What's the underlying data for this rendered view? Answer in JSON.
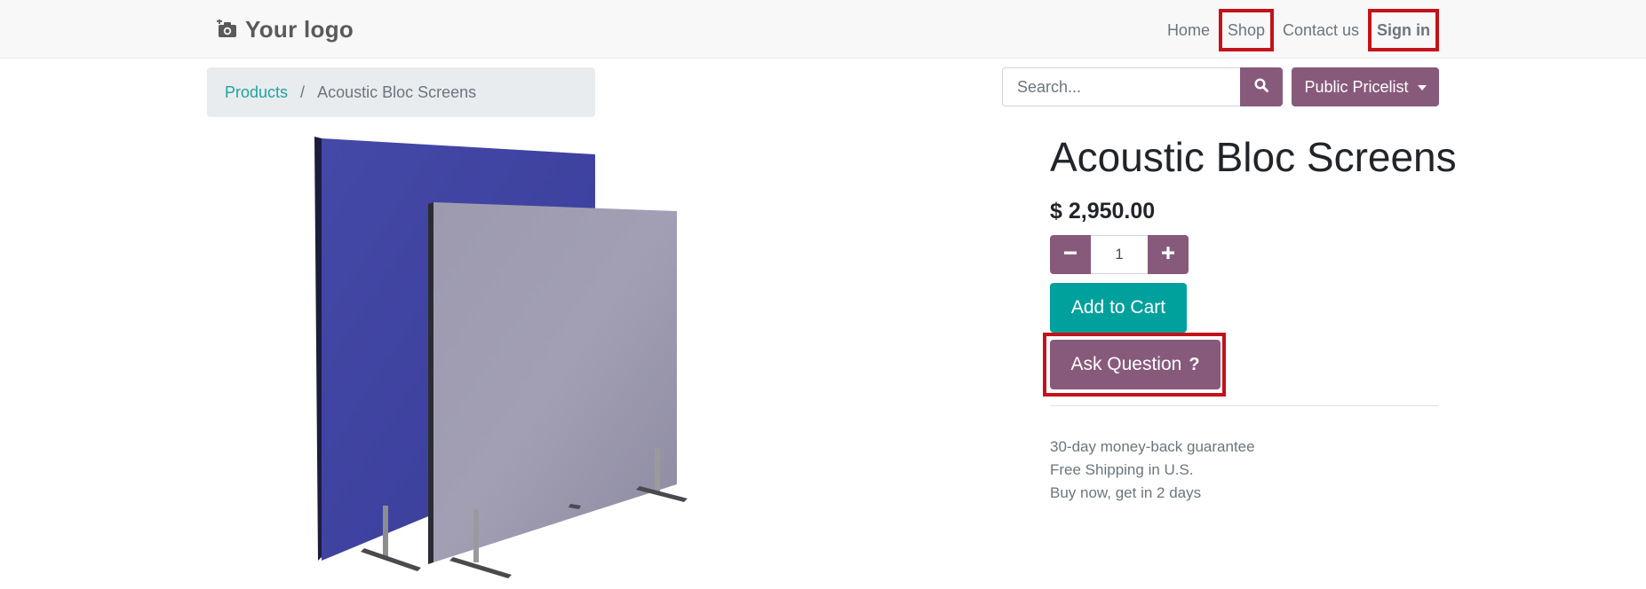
{
  "header": {
    "logo_text": "Your logo",
    "logo_icon": "camera-add-icon",
    "nav": {
      "home": "Home",
      "shop": "Shop",
      "contact": "Contact us",
      "signin": "Sign in"
    }
  },
  "breadcrumb": {
    "parent": "Products",
    "separator": "/",
    "current": "Acoustic Bloc Screens"
  },
  "search": {
    "placeholder": "Search...",
    "value": "",
    "icon": "search-icon"
  },
  "pricelist": {
    "label": "Public Pricelist"
  },
  "product": {
    "title": "Acoustic Bloc Screens",
    "price": "$ 2,950.00",
    "quantity": "1",
    "add_to_cart": "Add to Cart",
    "ask_question": "Ask Question",
    "ask_question_icon": "?",
    "perks": [
      "30-day money-back guarantee",
      "Free Shipping in U.S.",
      "Buy now, get in 2 days"
    ]
  },
  "colors": {
    "primary": "#875a7b",
    "secondary": "#00a09d",
    "highlight": "#c3131a",
    "link": "#20a39e"
  }
}
